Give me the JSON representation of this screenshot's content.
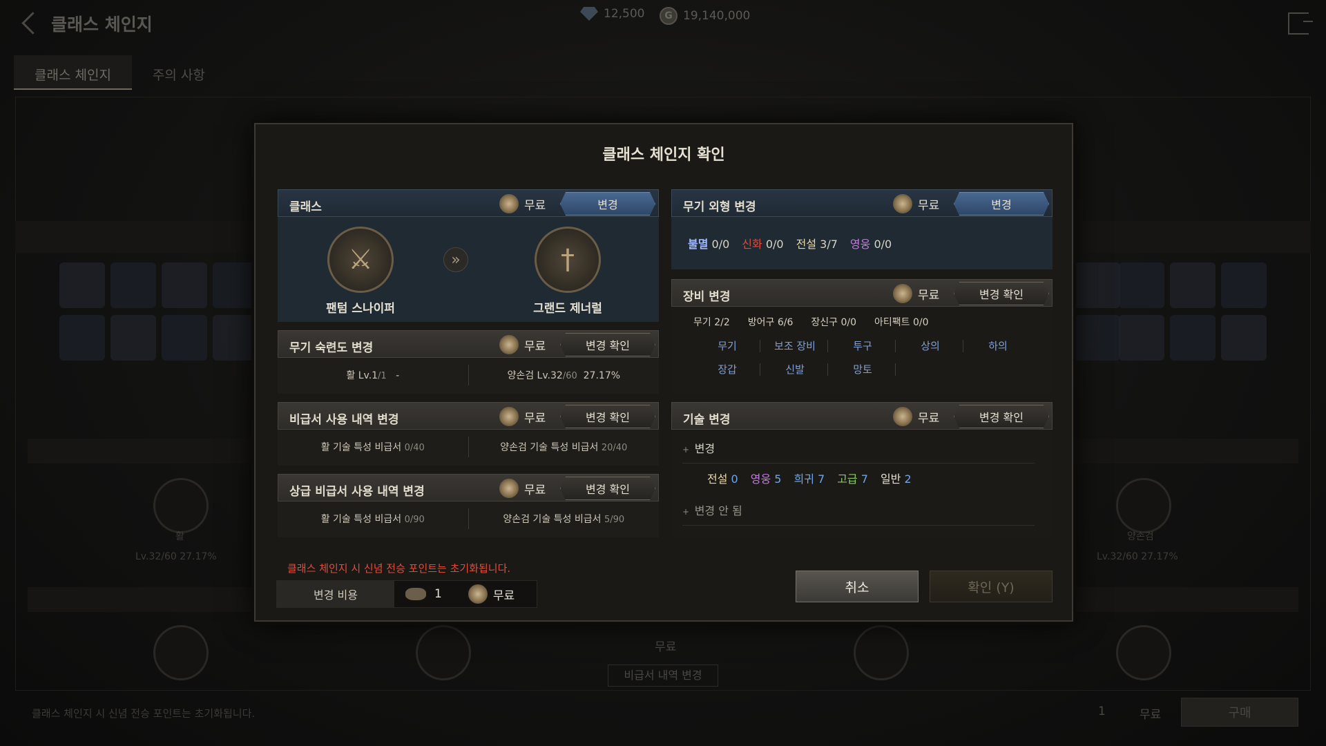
{
  "page": {
    "title": "클래스 체인지",
    "gem_amount": "12,500",
    "gold_amount": "19,140,000",
    "tabs": [
      "클래스 체인지",
      "주의 사항"
    ],
    "bottom_notice": "클래스 체인지 시 신념 전승 포인트는 초기화됩니다.",
    "buy_label": "구매",
    "bg_left_weapon": "활",
    "bg_left_level": "Lv.32/60  27.17%",
    "bg_right_weapon": "양손검",
    "bg_right_level": "Lv.32/60  27.17%",
    "bg_free": "무료",
    "bg_change_label": "비급서 내역 변경",
    "bottom_cost_count": "1",
    "bottom_free": "무료"
  },
  "modal": {
    "title": "클래스 체인지 확인",
    "class_section": {
      "title": "클래스",
      "cost": "무료",
      "button": "변경",
      "from": "팬텀 스나이퍼",
      "to": "그랜드 제너럴"
    },
    "weapon_skin": {
      "title": "무기 외형 변경",
      "cost": "무료",
      "button": "변경",
      "grades": [
        {
          "label": "불멸",
          "value": "0/0",
          "color": "#9fb8ff"
        },
        {
          "label": "신화",
          "value": "0/0",
          "color": "#e24c3b"
        },
        {
          "label": "전설",
          "value": "3/7",
          "color": "#e8d7a8"
        },
        {
          "label": "영웅",
          "value": "0/0",
          "color": "#c77be0"
        }
      ]
    },
    "mastery": {
      "title": "무기 숙련도 변경",
      "cost": "무료",
      "button": "변경 확인",
      "left": "활 Lv.1",
      "left_small": "/1",
      "left_dash": "-",
      "right": "양손검 Lv.32",
      "right_small": "/60",
      "right_pct": "27.17%"
    },
    "equip": {
      "title": "장비 변경",
      "cost": "무료",
      "button": "변경 확인",
      "counts": [
        "무기 2/2",
        "방어구 6/6",
        "장신구 0/0",
        "아티팩트 0/0"
      ],
      "links_row1": [
        "무기",
        "보조 장비",
        "투구",
        "상의",
        "하의"
      ],
      "links_row2": [
        "장갑",
        "신발",
        "망토"
      ]
    },
    "book": {
      "title": "비급서 사용 내역 변경",
      "cost": "무료",
      "button": "변경 확인",
      "left": "활 기술 특성 비급서",
      "left_small": "0/40",
      "right": "양손검 기술 특성 비급서",
      "right_small": "20/40"
    },
    "skill": {
      "title": "기술 변경",
      "cost": "무료",
      "button": "변경 확인",
      "changed_label": "변경",
      "unchanged_label": "변경 안 됨",
      "grades": [
        {
          "label": "전설",
          "value": "0",
          "color": "#e8d7a8"
        },
        {
          "label": "영웅",
          "value": "5",
          "color": "#c77be0"
        },
        {
          "label": "희귀",
          "value": "7",
          "color": "#6ea7e8"
        },
        {
          "label": "고급",
          "value": "7",
          "color": "#8ec86a"
        },
        {
          "label": "일반",
          "value": "2",
          "color": "#e7e1d3"
        }
      ]
    },
    "premium_book": {
      "title": "상급 비급서 사용 내역 변경",
      "cost": "무료",
      "button": "변경 확인",
      "left": "활 기술 특성 비급서",
      "left_small": "0/90",
      "right": "양손검 기술 특성 비급서",
      "right_small": "5/90"
    },
    "warning": "클래스 체인지 시 신념 전승 포인트는 초기화됩니다.",
    "cost_label": "변경 비용",
    "cost_count": "1",
    "cost_free": "무료",
    "cancel": "취소",
    "confirm": "확인 (Y)"
  }
}
